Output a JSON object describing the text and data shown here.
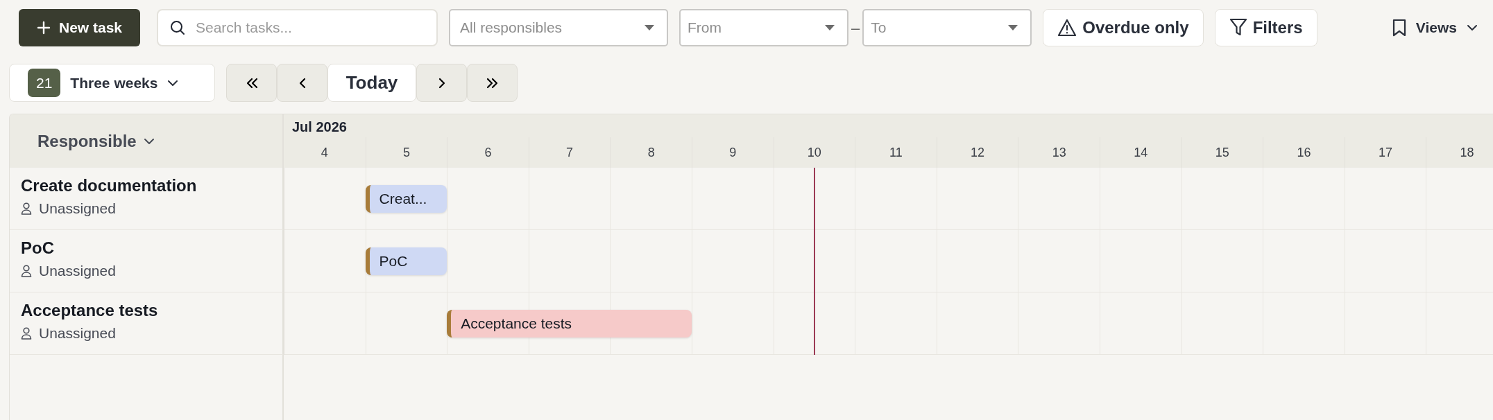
{
  "toolbar": {
    "new_task": {
      "label": "New task"
    },
    "search": {
      "placeholder": "Search tasks..."
    },
    "responsible_filter": {
      "value": "All responsibles"
    },
    "date_from": {
      "placeholder": "From"
    },
    "date_separator": "–",
    "date_to": {
      "placeholder": "To"
    },
    "overdue_button": {
      "label": "Overdue only"
    },
    "filters_button": {
      "label": "Filters"
    },
    "views_button": {
      "label": "Views"
    }
  },
  "range": {
    "count": "21",
    "label": "Three weeks"
  },
  "navigation": {
    "today_label": "Today"
  },
  "gantt": {
    "column_header": "Responsible",
    "month": "Jul 2026",
    "days": [
      {
        "label": "4",
        "today": false
      },
      {
        "label": "5",
        "today": false
      },
      {
        "label": "6",
        "today": false
      },
      {
        "label": "7",
        "today": false
      },
      {
        "label": "8",
        "today": false
      },
      {
        "label": "9",
        "today": false
      },
      {
        "label": "10",
        "today": true
      },
      {
        "label": "11",
        "today": false
      },
      {
        "label": "12",
        "today": false
      },
      {
        "label": "13",
        "today": false
      },
      {
        "label": "14",
        "today": false
      },
      {
        "label": "15",
        "today": false
      },
      {
        "label": "16",
        "today": false
      },
      {
        "label": "17",
        "today": false
      },
      {
        "label": "18",
        "today": false
      }
    ],
    "rows": [
      {
        "title": "Create documentation",
        "assignee": "Unassigned",
        "bar": {
          "label": "Creat...",
          "color": "#cfd9f4"
        },
        "cells": [
          {
            "in_bar": false
          },
          {
            "in_bar": true
          },
          {
            "in_bar": false
          },
          {
            "in_bar": false
          },
          {
            "in_bar": false
          },
          {
            "in_bar": false
          },
          {
            "in_bar": false
          },
          {
            "in_bar": false
          },
          {
            "in_bar": false
          },
          {
            "in_bar": false
          },
          {
            "in_bar": false
          },
          {
            "in_bar": false
          },
          {
            "in_bar": false
          },
          {
            "in_bar": false
          },
          {
            "in_bar": false
          }
        ]
      },
      {
        "title": "PoC",
        "assignee": "Unassigned",
        "bar": {
          "label": "PoC",
          "color": "#cfd9f4"
        },
        "cells": [
          {
            "in_bar": false
          },
          {
            "in_bar": true
          },
          {
            "in_bar": false
          },
          {
            "in_bar": false
          },
          {
            "in_bar": false
          },
          {
            "in_bar": false
          },
          {
            "in_bar": false
          },
          {
            "in_bar": false
          },
          {
            "in_bar": false
          },
          {
            "in_bar": false
          },
          {
            "in_bar": false
          },
          {
            "in_bar": false
          },
          {
            "in_bar": false
          },
          {
            "in_bar": false
          },
          {
            "in_bar": false
          }
        ]
      },
      {
        "title": "Acceptance tests",
        "assignee": "Unassigned",
        "bar": {
          "label": "Acceptance tests",
          "color": "#f6cac9"
        },
        "cells": [
          {
            "in_bar": false
          },
          {
            "in_bar": false
          },
          {
            "in_bar": true
          },
          {
            "in_bar": true
          },
          {
            "in_bar": true
          },
          {
            "in_bar": false
          },
          {
            "in_bar": false
          },
          {
            "in_bar": false
          },
          {
            "in_bar": false
          },
          {
            "in_bar": false
          },
          {
            "in_bar": false
          },
          {
            "in_bar": false
          },
          {
            "in_bar": false
          },
          {
            "in_bar": false
          },
          {
            "in_bar": false
          }
        ]
      }
    ]
  }
}
